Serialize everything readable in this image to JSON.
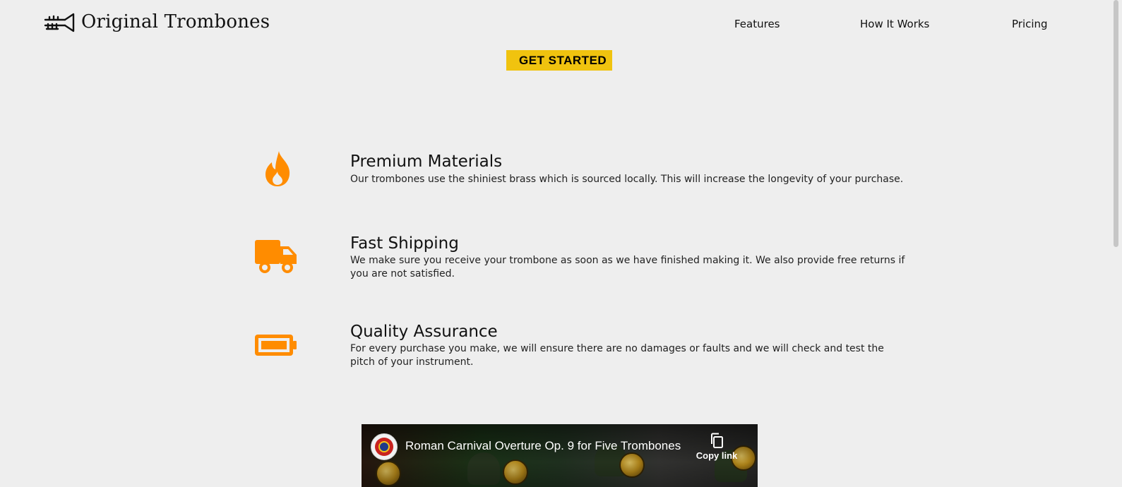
{
  "header": {
    "brand_name": "Original Trombones",
    "logo_icon": "trumpet-icon",
    "nav": [
      {
        "label": "Features"
      },
      {
        "label": "How It Works"
      },
      {
        "label": "Pricing"
      }
    ]
  },
  "cta": {
    "label": "GET STARTED"
  },
  "features": [
    {
      "icon": "fire-icon",
      "title": "Premium Materials",
      "description": "Our trombones use the shiniest brass which is sourced locally. This will increase the longevity of your purchase."
    },
    {
      "icon": "truck-icon",
      "title": "Fast Shipping",
      "description": "We make sure you receive your trombone as soon as we have finished making it. We also provide free returns if you are not satisfied."
    },
    {
      "icon": "battery-icon",
      "title": "Quality Assurance",
      "description": "For every purchase you make, we will ensure there are no damages or faults and we will check and test the pitch of your instrument."
    }
  ],
  "video": {
    "title": "Roman Carnival Overture Op. 9 for Five Trombones",
    "copy_label": "Copy link"
  },
  "colors": {
    "accent_orange": "#ff8c00",
    "cta_yellow": "#f0c30f",
    "background": "#eeeeee"
  }
}
